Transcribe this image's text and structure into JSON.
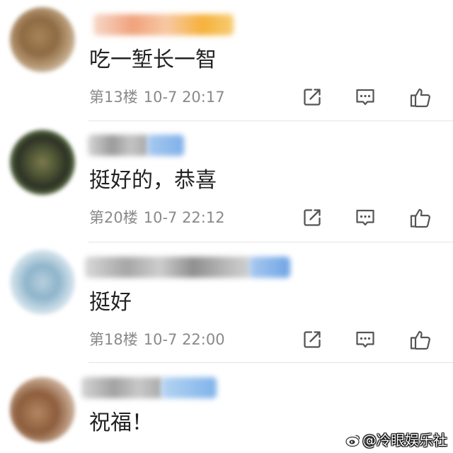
{
  "comments": [
    {
      "text": "吃一堑长一智",
      "floor": "第13楼",
      "datetime": "10-7 20:17"
    },
    {
      "text": "挺好的，恭喜",
      "floor": "第20楼",
      "datetime": "10-7 22:12"
    },
    {
      "text": "挺好",
      "floor": "第18楼",
      "datetime": "10-7 22:00"
    },
    {
      "text": "祝福！"
    }
  ],
  "actions": {
    "share_icon": "share-icon",
    "reply_icon": "comment-icon",
    "like_icon": "thumbs-up-icon"
  },
  "watermark": "@冷眼娱乐社",
  "colors": {
    "background": "#ffffff",
    "comment_text": "#222222",
    "meta_text": "#8a8a8a",
    "icon": "#555555",
    "divider": "#e4e4e4"
  }
}
